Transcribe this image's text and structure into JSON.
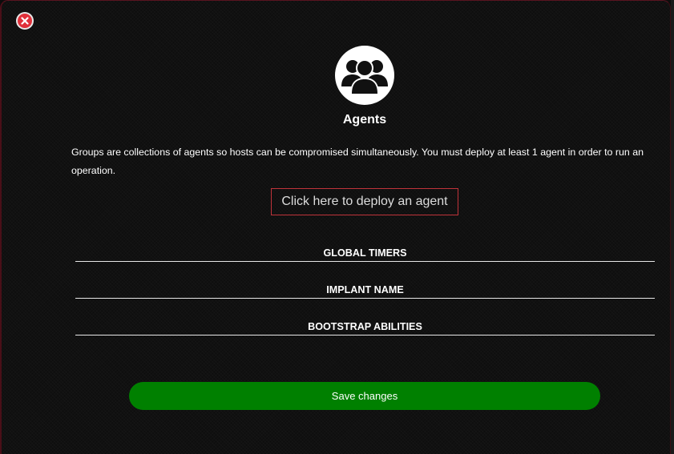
{
  "modal": {
    "title": "Agents",
    "description": "Groups are collections of agents so hosts can be compromised simultaneously. You must deploy at least 1 agent in order to run an operation.",
    "deploy_label": "Click here to deploy an agent",
    "sections": [
      {
        "label": "GLOBAL TIMERS"
      },
      {
        "label": "IMPLANT NAME"
      },
      {
        "label": "BOOTSTRAP ABILITIES"
      }
    ],
    "save_label": "Save changes"
  },
  "icons": {
    "close": "close-icon",
    "agents": "users-group-icon"
  },
  "colors": {
    "accent_border": "#c0333a",
    "close": "#e0303a",
    "save": "#008000",
    "background": "#111111"
  }
}
